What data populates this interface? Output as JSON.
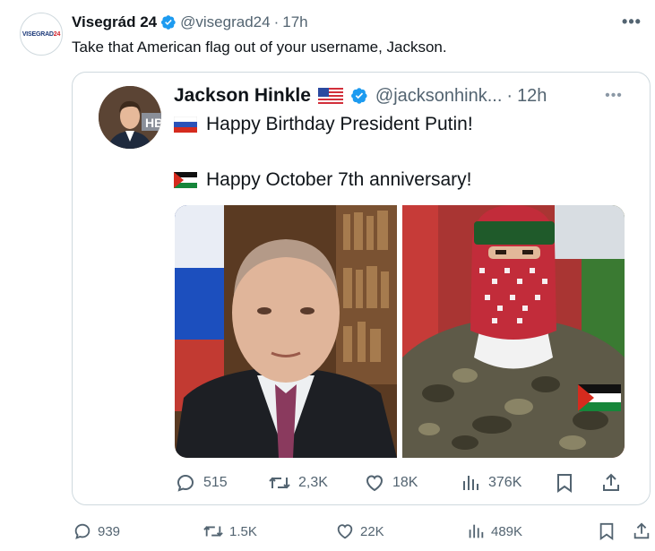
{
  "tweet": {
    "author_name": "Visegrád 24",
    "avatar_text_a": "VISEGRAD",
    "avatar_text_b": "24",
    "handle": "@visegrad24",
    "separator": "·",
    "time": "17h",
    "more": "•••",
    "text": "Take that American flag out of your username, Jackson.",
    "stats": {
      "replies": "939",
      "retweets": "1.5K",
      "likes": "22K",
      "views": "489K"
    }
  },
  "quote": {
    "author_name": "Jackson Hinkle",
    "handle": "@jacksonhink...",
    "separator": "·",
    "time": "12h",
    "more": "•••",
    "line1": "Happy Birthday President Putin!",
    "line2": "Happy October 7th anniversary!",
    "stats": {
      "replies": "515",
      "retweets": "2,3K",
      "likes": "18K",
      "views": "376K"
    }
  },
  "colors": {
    "verified": "#1d9bf0",
    "text": "#0f1419",
    "muted": "#536471",
    "border": "#cfd9de"
  },
  "icons": [
    "verified-icon",
    "more-icon",
    "reply-icon",
    "retweet-icon",
    "like-icon",
    "views-icon",
    "bookmark-icon",
    "share-icon",
    "us-flag-icon",
    "russia-flag-icon",
    "palestine-flag-icon"
  ]
}
